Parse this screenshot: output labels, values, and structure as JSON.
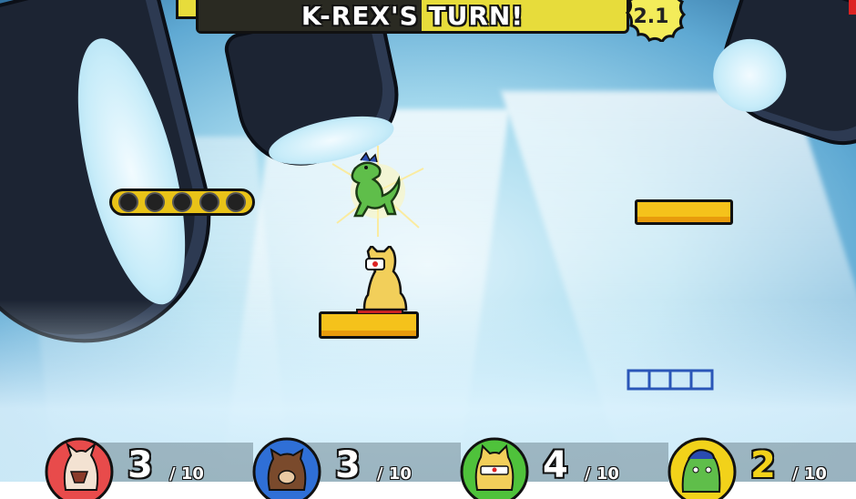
{
  "banner": {
    "turn_text": "K-REX'S TURN!",
    "timer": "2.1"
  },
  "players": [
    {
      "name": "horse",
      "score": "3",
      "max": "/ 10",
      "color": "#e84b4b",
      "icon": "horse-avatar-icon"
    },
    {
      "name": "bear",
      "score": "3",
      "max": "/ 10",
      "color": "#2f6fd6",
      "icon": "raccoon-avatar-icon"
    },
    {
      "name": "cat",
      "score": "4",
      "max": "/ 10",
      "color": "#4fc23b",
      "icon": "cat-avatar-icon"
    },
    {
      "name": "k-rex",
      "score": "2",
      "max": "/ 10",
      "color": "#f2d21a",
      "icon": "dinosaur-avatar-icon"
    }
  ],
  "colors": {
    "platform": "#f5c21b",
    "banner": "#e7dc3b",
    "sky": "#a9dcef"
  }
}
